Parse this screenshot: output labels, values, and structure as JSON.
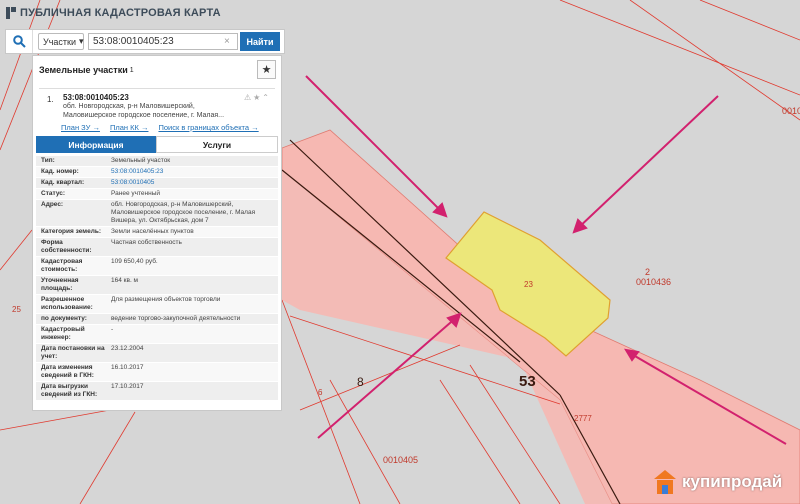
{
  "app": {
    "title": "ПУБЛИЧНАЯ КАДАСТРОВАЯ КАРТА"
  },
  "search": {
    "type_selected": "Участки",
    "query": "53:08:0010405:23",
    "clear_symbol": "×",
    "find_button": "Найти"
  },
  "panel": {
    "title": "Земельные участки",
    "count": "1",
    "result": {
      "number": "1.",
      "cad_number": "53:08:0010405:23",
      "address_lines": [
        "обл. Новгородская, р-н Маловишерский,",
        "Маловишерское городское поселение, г. Малая..."
      ],
      "links": [
        "План ЗУ →",
        "План КК →",
        "Поиск в границах объекта →"
      ]
    },
    "tabs": [
      "Информация",
      "Услуги"
    ],
    "rows": [
      {
        "label": "Тип:",
        "value": "Земельный участок"
      },
      {
        "label": "Кад. номер:",
        "value": "53:08:0010405:23"
      },
      {
        "label": "Кад. квартал:",
        "value": "53:08:0010405"
      },
      {
        "label": "Статус:",
        "value": "Ранее учтенный"
      },
      {
        "label": "Адрес:",
        "value": "обл. Новгородская, р-н Маловишерский, Маловишерское городское поселение, г. Малая Вишера, ул. Октябрьская, дом 7"
      },
      {
        "label": "Категория земель:",
        "value": "Земли населённых пунктов"
      },
      {
        "label": "Форма собственности:",
        "value": "Частная собственность"
      },
      {
        "label": "Кадастровая стоимость:",
        "value": "109 650,40 руб."
      },
      {
        "label": "Уточненная площадь:",
        "value": "164 кв. м"
      },
      {
        "label": "Разрешенное использование:",
        "value": "Для размещения объектов торговли"
      },
      {
        "label": "по документу:",
        "value": "ведение торгово-закупочной деятельности"
      },
      {
        "label": "Кадастровый инженер:",
        "value": "-"
      },
      {
        "label": "Дата постановки на учет:",
        "value": "23.12.2004"
      },
      {
        "label": "Дата изменения сведений в ГКН:",
        "value": "16.10.2017"
      },
      {
        "label": "Дата выгрузки сведений из ГКН:",
        "value": "17.10.2017"
      }
    ]
  },
  "map": {
    "labels": {
      "l0010": "0010",
      "l2": "2",
      "l0010436": "0010436",
      "l25": "25",
      "l23": "23",
      "l6": "6",
      "l8": "8",
      "l53": "53",
      "l2777": "2777",
      "l0010405": "0010405"
    },
    "colors": {
      "background": "#d6d6d6",
      "road": "#f6b8b2",
      "parcel": "#ece77a",
      "arrow": "#d2216e",
      "boundary": "#e03a2f"
    }
  },
  "watermark": {
    "text": "купипродай"
  }
}
